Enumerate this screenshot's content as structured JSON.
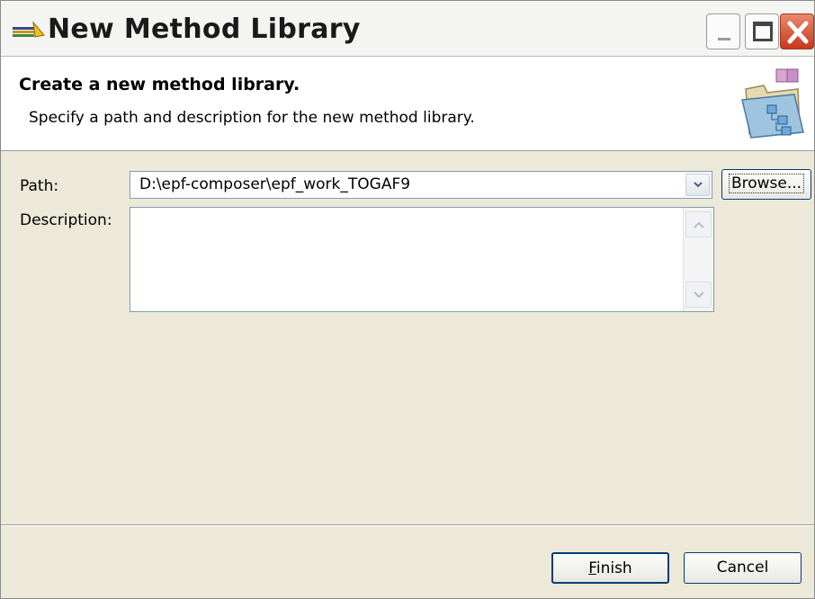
{
  "window": {
    "title": "New Method Library",
    "icon": "method-library-icon"
  },
  "banner": {
    "title": "Create a new method library.",
    "description": "Specify a path and description for the new method library.",
    "icon": "library-folder-icon"
  },
  "form": {
    "path_label": "Path:",
    "path_value": "D:\\epf-composer\\epf_work_TOGAF9",
    "browse_label": "Browse...",
    "description_label": "Description:",
    "description_value": ""
  },
  "buttons": {
    "finish_mnemonic": "F",
    "finish_rest": "inish",
    "cancel_label": "Cancel"
  }
}
